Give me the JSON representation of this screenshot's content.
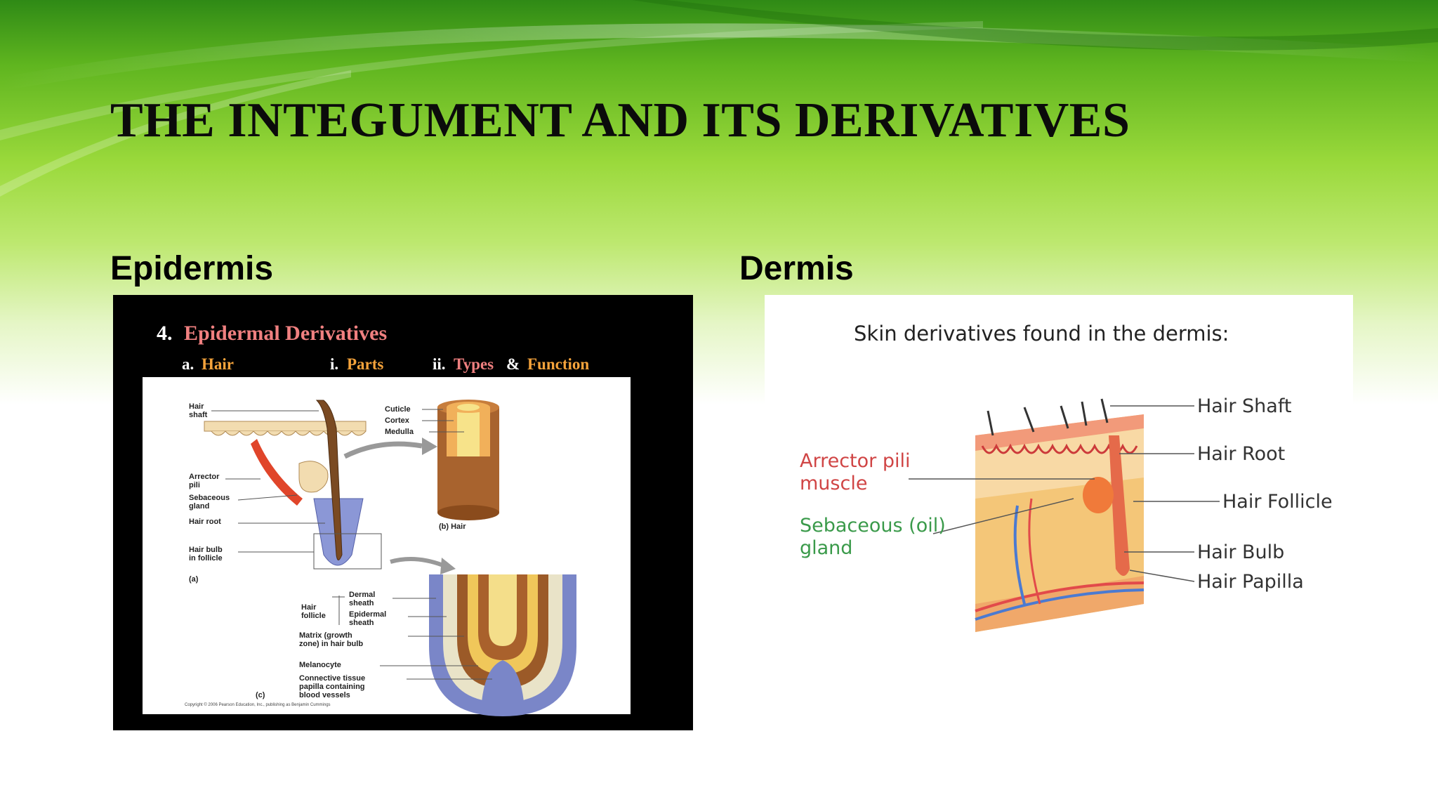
{
  "slide": {
    "title": "THE INTEGUMENT AND ITS DERIVATIVES",
    "left_heading": "Epidermis",
    "right_heading": "Dermis"
  },
  "colors": {
    "accent_green": "#7ecb2a",
    "header_pink": "#f08080",
    "header_orange": "#f5a33b"
  },
  "epidermal_figure": {
    "number": "4.",
    "title": "Epidermal Derivatives",
    "sub_a_prefix": "a.",
    "sub_a": "Hair",
    "sub_i_prefix": "i.",
    "sub_i": "Parts",
    "sub_ii_prefix": "ii.",
    "sub_ii_types": "Types",
    "sub_ii_amp": "&",
    "sub_ii_function": "Function",
    "labels": {
      "hair_shaft_1": "Hair",
      "hair_shaft_2": "shaft",
      "arrector_1": "Arrector",
      "arrector_2": "pili",
      "sebaceous_1": "Sebaceous",
      "sebaceous_2": "gland",
      "hair_root": "Hair root",
      "bulb_1": "Hair bulb",
      "bulb_2": "in follicle",
      "panel_a": "(a)",
      "cuticle": "Cuticle",
      "cortex": "Cortex",
      "medulla": "Medulla",
      "panel_b": "(b) Hair",
      "dermal_1": "Dermal",
      "dermal_2": "sheath",
      "follicle_1": "Hair",
      "follicle_2": "follicle",
      "epidermal_1": "Epidermal",
      "epidermal_2": "sheath",
      "matrix_1": "Matrix (growth",
      "matrix_2": "zone) in hair bulb",
      "melanocyte": "Melanocyte",
      "connective_1": "Connective tissue",
      "connective_2": "papilla containing",
      "connective_3": "blood vessels",
      "panel_c": "(c)",
      "copyright": "Copyright © 2006 Pearson Education, Inc., publishing as Benjamin Cummings"
    }
  },
  "dermis_figure": {
    "title": "Skin derivatives found in the dermis:",
    "labels": {
      "arrector_1": "Arrector pili",
      "arrector_2": "muscle",
      "sebaceous_1": "Sebaceous (oil)",
      "sebaceous_2": "gland",
      "hair_shaft": "Hair Shaft",
      "hair_root": "Hair Root",
      "hair_follicle": "Hair Follicle",
      "hair_bulb": "Hair Bulb",
      "hair_papilla": "Hair Papilla"
    }
  }
}
